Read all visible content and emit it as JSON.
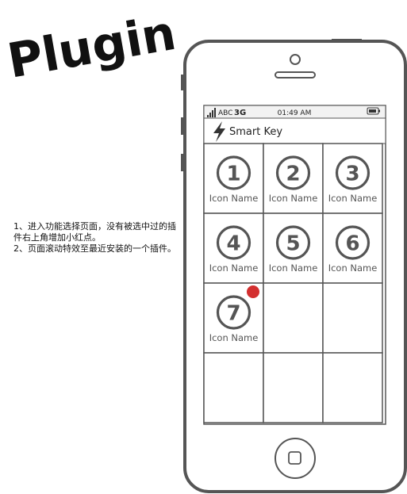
{
  "title": "Plugin",
  "note": {
    "line1": "1、进入功能选择页面，没有被选中过的插件右上角增加小红点。",
    "line2": "2、页面滚动特效至最近安装的一个插件。"
  },
  "status_bar": {
    "carrier": "ABC",
    "network": "3G",
    "time": "01:49 AM"
  },
  "header": {
    "icon": "lightning-icon",
    "title": "Smart Key"
  },
  "grid": {
    "items": [
      {
        "number": "1",
        "label": "Icon Name",
        "new_badge": false
      },
      {
        "number": "2",
        "label": "Icon Name",
        "new_badge": false
      },
      {
        "number": "3",
        "label": "Icon Name",
        "new_badge": false
      },
      {
        "number": "4",
        "label": "Icon Name",
        "new_badge": false
      },
      {
        "number": "5",
        "label": "Icon Name",
        "new_badge": false
      },
      {
        "number": "6",
        "label": "Icon Name",
        "new_badge": false
      },
      {
        "number": "7",
        "label": "Icon Name",
        "new_badge": true
      }
    ],
    "badge_color": "#d32f2f"
  }
}
